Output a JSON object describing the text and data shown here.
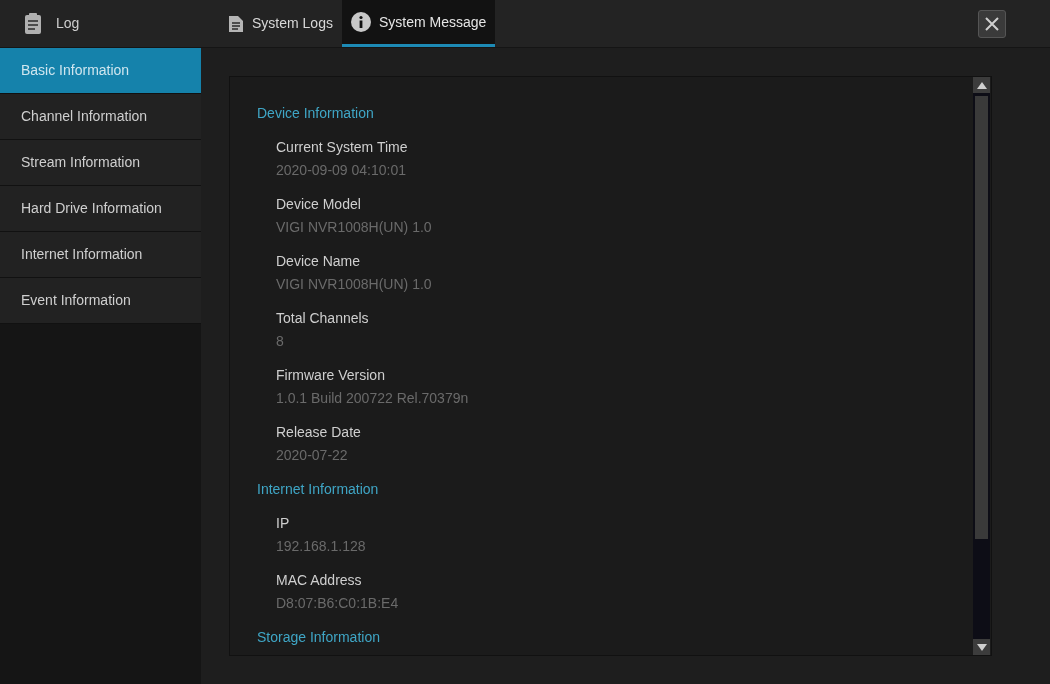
{
  "header": {
    "title": "Log"
  },
  "tabs": [
    {
      "label": "System Logs",
      "kind": "document",
      "selected": false
    },
    {
      "label": "System Message",
      "kind": "info",
      "selected": true
    }
  ],
  "sidebar": {
    "items": [
      {
        "label": "Basic Information",
        "selected": true
      },
      {
        "label": "Channel Information",
        "selected": false
      },
      {
        "label": "Stream Information",
        "selected": false
      },
      {
        "label": "Hard Drive Information",
        "selected": false
      },
      {
        "label": "Internet Information",
        "selected": false
      },
      {
        "label": "Event Information",
        "selected": false
      }
    ]
  },
  "sections": [
    {
      "title": "Device Information",
      "fields": [
        {
          "label": "Current System Time",
          "value": "2020-09-09 04:10:01"
        },
        {
          "label": "Device Model",
          "value": "VIGI NVR1008H(UN) 1.0"
        },
        {
          "label": "Device Name",
          "value": "VIGI NVR1008H(UN) 1.0"
        },
        {
          "label": "Total Channels",
          "value": "8"
        },
        {
          "label": "Firmware Version",
          "value": "1.0.1 Build 200722 Rel.70379n"
        },
        {
          "label": "Release Date",
          "value": "2020-07-22"
        }
      ]
    },
    {
      "title": "Internet Information",
      "fields": [
        {
          "label": "IP",
          "value": "192.168.1.128"
        },
        {
          "label": "MAC Address",
          "value": "D8:07:B6:C0:1B:E4"
        }
      ]
    },
    {
      "title": "Storage Information"
    }
  ]
}
